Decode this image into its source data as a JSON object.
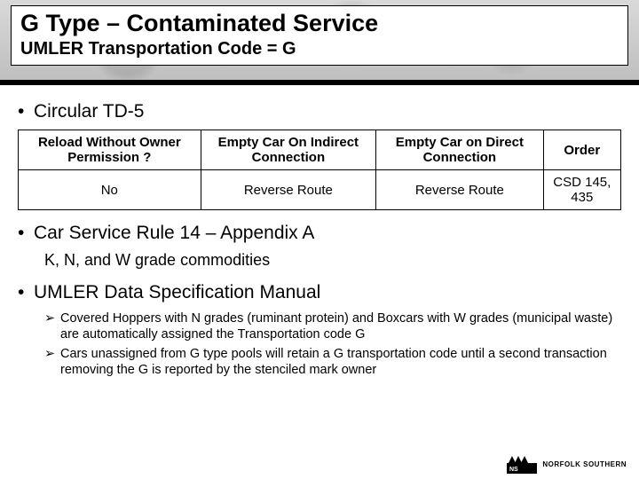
{
  "header": {
    "title": "G Type – Contaminated Service",
    "subtitle": "UMLER Transportation Code = G"
  },
  "bullets": {
    "b1_circular": "Circular TD-5",
    "b1_rule14": "Car Service Rule 14 – Appendix A",
    "b2_commodities": "K, N, and W grade commodities",
    "b1_umler": "UMLER Data Specification Manual",
    "b3_cov": "Covered Hoppers with N grades (ruminant protein) and Boxcars with W grades (municipal waste) are automatically assigned the Transportation code G",
    "b3_unassigned": "Cars unassigned from G type pools will retain a G transportation code until a second transaction removing the G is reported by the stenciled mark owner"
  },
  "table": {
    "headers": {
      "c0": "Reload  Without Owner Permission ?",
      "c1": "Empty Car On Indirect Connection",
      "c2": "Empty Car on Direct Connection",
      "c3": "Order"
    },
    "row": {
      "c0": "No",
      "c1": "Reverse Route",
      "c2": "Reverse Route",
      "c3": "CSD 145, 435"
    }
  },
  "footer": {
    "brand": "NORFOLK SOUTHERN"
  },
  "chart_data": {
    "type": "table",
    "headers": [
      "Reload Without Owner Permission ?",
      "Empty Car On Indirect Connection",
      "Empty Car on Direct Connection",
      "Order"
    ],
    "rows": [
      [
        "No",
        "Reverse Route",
        "Reverse Route",
        "CSD 145, 435"
      ]
    ]
  }
}
